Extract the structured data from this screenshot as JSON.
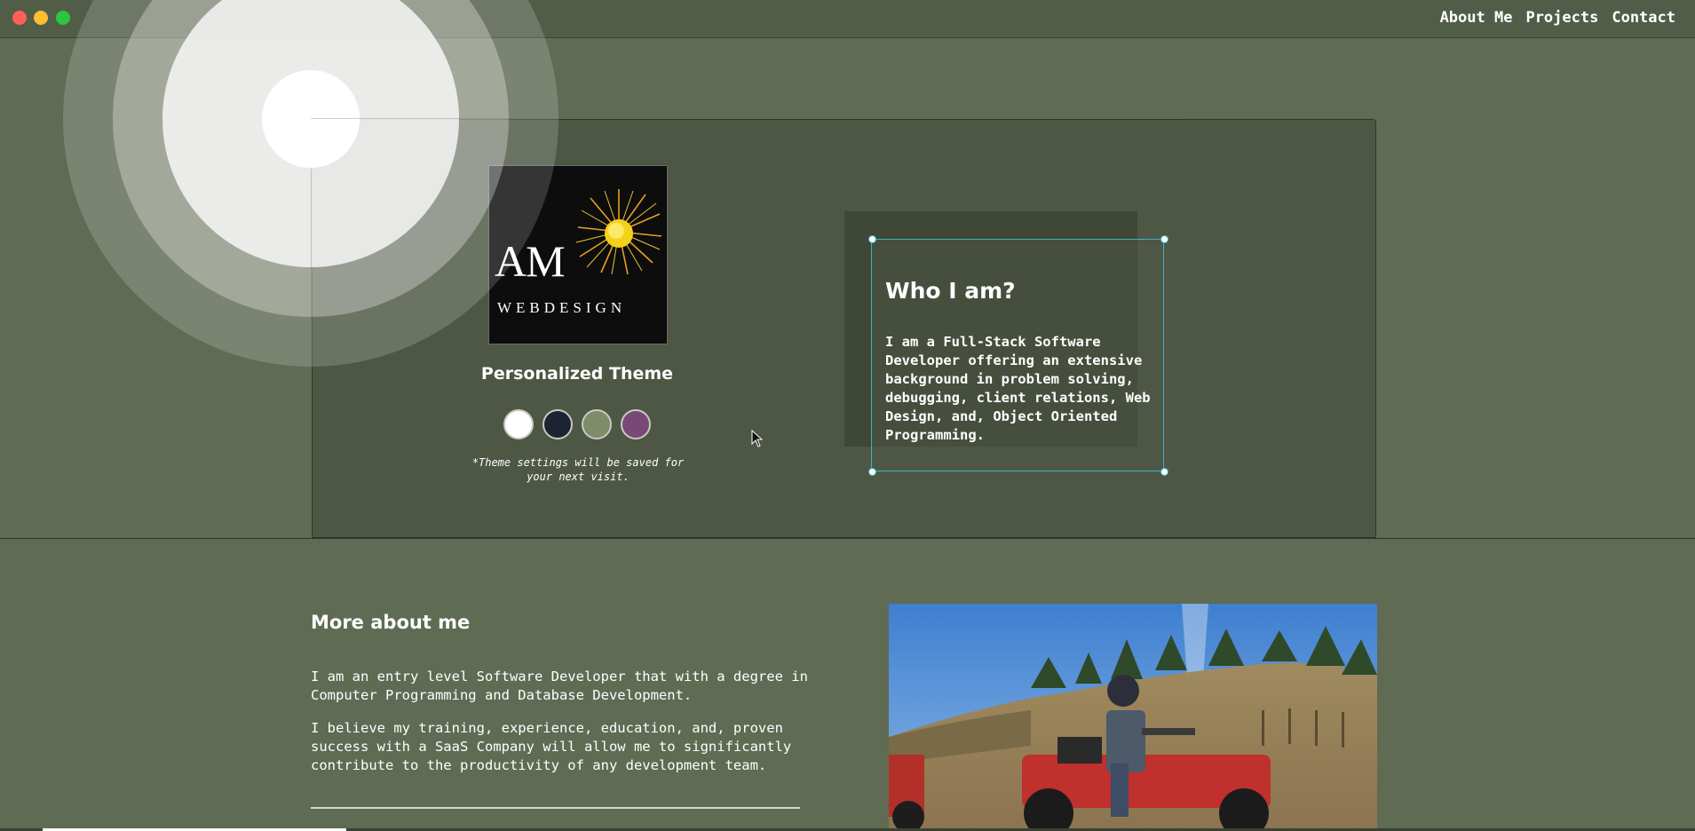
{
  "nav": {
    "about": "About Me",
    "projects": "Projects",
    "contact": "Contact"
  },
  "logo": {
    "main": "AM",
    "sub": "WEBDESIGN"
  },
  "theme": {
    "title": "Personalized Theme",
    "note": "*Theme settings will be saved for your next visit.",
    "swatch_colors": [
      "#ffffff",
      "#1c2333",
      "#7f8c6a",
      "#7a4878"
    ]
  },
  "who": {
    "title": "Who I am?",
    "text": "I am a Full-Stack Software Developer offering an extensive background in problem solving, debugging, client relations, Web Design, and, Object Oriented Programming."
  },
  "more": {
    "title": "More about me",
    "p1": "I am an entry level Software Developer that with a degree in Computer Programming and Database Development.",
    "p2": "I believe my training, experience, education, and, proven success with a SaaS Company will allow me to significantly contribute to the productivity of any development team."
  }
}
